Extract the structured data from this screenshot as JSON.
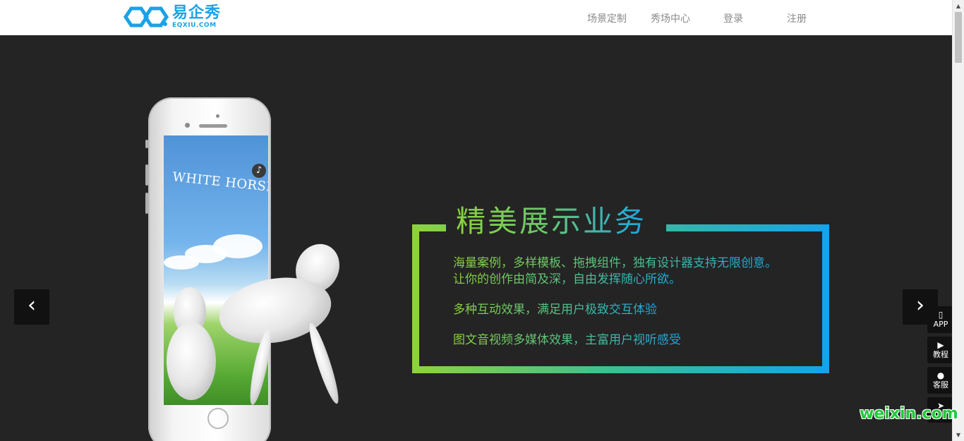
{
  "header": {
    "logo": {
      "cn": "易企秀",
      "en": "EQXIU.COM"
    },
    "nav": [
      {
        "label": "场景定制"
      },
      {
        "label": "秀场中心"
      },
      {
        "label": "登录"
      },
      {
        "label": "注册"
      }
    ]
  },
  "banner": {
    "phone_screen_title": "WHITE HORSE",
    "title": "精美展示业务",
    "lines": [
      "海量案例，多样模板、拖拽组件，独有设计器支持无限创意。",
      "让你的创作由简及深，自由发挥随心所欲。",
      "多种互动效果，满足用户极致交互体验",
      "图文音视频多媒体效果，主富用户视听感受"
    ],
    "prev_icon": "chevron-left",
    "next_icon": "chevron-right"
  },
  "side_widget": [
    {
      "icon": "phone-icon",
      "label": "APP"
    },
    {
      "icon": "play-icon",
      "label": "教程"
    },
    {
      "icon": "user-icon",
      "label": "客服"
    },
    {
      "icon": "send-icon",
      "label": ""
    }
  ],
  "watermark": "weixin.com",
  "colors": {
    "brand": "#1ba2e6",
    "green": "#8cd23f",
    "banner_bg": "#242424"
  }
}
